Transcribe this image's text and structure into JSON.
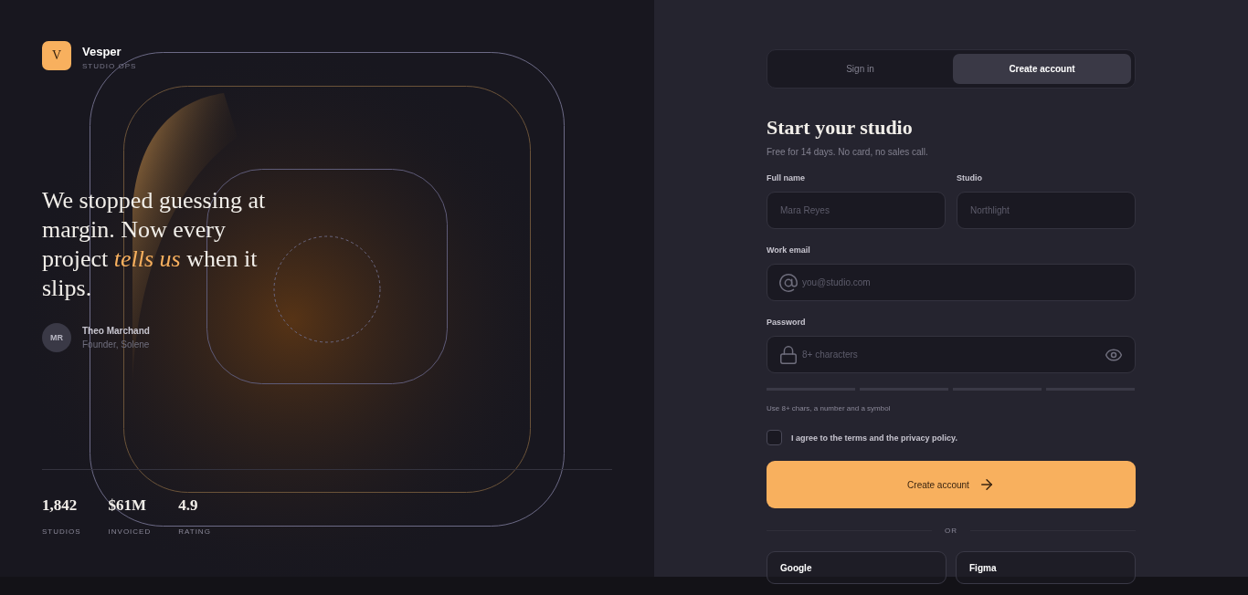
{
  "brand": {
    "logo_letter": "V",
    "name": "Vesper",
    "tagline": "STUDIO OPS"
  },
  "testimonial": {
    "quote": "We stopped guessing at margin. Now every project *tells us* when it slips.",
    "avatar_initials": "MR",
    "author": "Theo Marchand",
    "role": "Founder, Solene"
  },
  "stats": [
    {
      "value": "1,842",
      "label": "STUDIOS"
    },
    {
      "value": "$61M",
      "label": "INVOICED"
    },
    {
      "value": "4.9",
      "label": "RATING"
    }
  ],
  "tabs": [
    {
      "label": "Sign in",
      "selected": false
    },
    {
      "label": "Create account",
      "selected": true
    }
  ],
  "heading": "Start your studio",
  "subheading": "Free for 14 days. No card, no sales call.",
  "fields": [
    {
      "label": "Full name",
      "placeholder": "Mara Reyes"
    },
    {
      "label": "Studio",
      "placeholder": "Northlight"
    }
  ],
  "email": {
    "label": "Work email",
    "placeholder": "you@studio.com"
  },
  "password": {
    "label": "Password",
    "placeholder": "8+ characters",
    "strength": {
      "level": 0
    },
    "hint": "Use 8+ chars, a number and a symbol"
  },
  "agree": {
    "label": "I agree to the terms and the privacy policy.",
    "checked": false
  },
  "submit": {
    "label": "Create account"
  },
  "divider": "OR",
  "social": [
    "Google",
    "Figma"
  ]
}
